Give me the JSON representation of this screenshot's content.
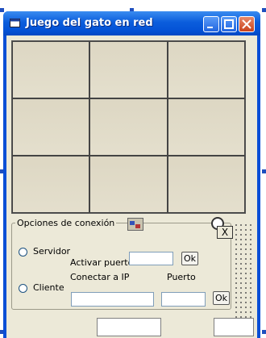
{
  "window": {
    "title": "Juego del gato en red"
  },
  "board": {
    "cells": [
      "",
      "",
      "",
      "",
      "",
      "",
      "",
      "",
      ""
    ]
  },
  "connection": {
    "frame_label": "Opciones de conexión",
    "server_label": "Servidor",
    "client_label": "Cliente",
    "activate_port_label": "Activar puerto",
    "connect_ip_label": "Conectar a IP",
    "port_label": "Puerto",
    "ok_label": "Ok",
    "ok2_label": "Ok",
    "close_label": "X",
    "activate_port_value": "",
    "ip_value": "",
    "port_value": ""
  },
  "status": {
    "field1": "",
    "field2": ""
  },
  "icons": {
    "window": "window-icon",
    "minimize": "minimize-icon",
    "maximize": "maximize-icon",
    "close": "close-icon",
    "winsock": "network-control-icon",
    "timer": "timer-icon"
  },
  "colors": {
    "titlebar": "#0b5ddc",
    "client": "#ece9d8",
    "selection_handle": "#1f4fbf"
  }
}
